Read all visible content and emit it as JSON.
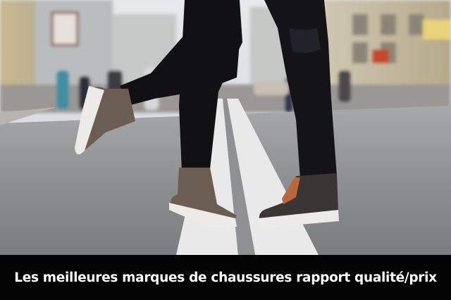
{
  "caption": {
    "text": "Les meilleures marques de chaussures rapport qualité/prix"
  },
  "photo": {
    "subject": "street-photo-legs-sneakers",
    "colors": {
      "road": "#8e8f91",
      "lane_marking": "#e9e9e9",
      "leggings": "#111114",
      "shoe_taupe": "#6b5d52",
      "shoe_dark": "#3b3633",
      "sole": "#ecebe8",
      "caption_bg": "#030303",
      "caption_text": "#ffffff"
    }
  }
}
